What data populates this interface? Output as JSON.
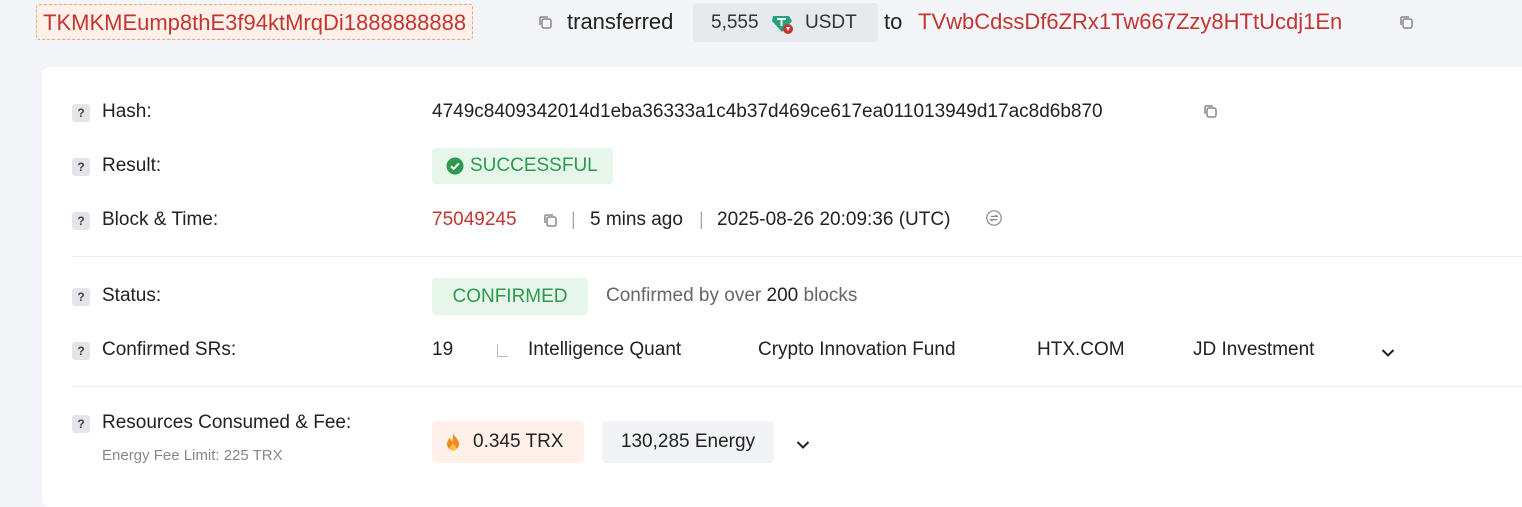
{
  "header": {
    "from_address": "TKMKMEump8thE3f94ktMrqDi1888888888",
    "verb": "transferred",
    "amount": "5,555",
    "token_symbol": "USDT",
    "token_icon": "tether-icon",
    "to_word": "to",
    "to_address": "TVwbCdssDf6ZRx1Tw667Zzy8HTtUcdj1En"
  },
  "details": {
    "hash": {
      "label": "Hash:",
      "value": "4749c8409342014d1eba36333a1c4b37d469ce617ea011013949d17ac8d6b870"
    },
    "result": {
      "label": "Result:",
      "value": "SUCCESSFUL"
    },
    "block_time": {
      "label": "Block & Time:",
      "block": "75049245",
      "sep": "|",
      "ago": "5 mins ago",
      "timestamp": "2025-08-26 20:09:36 (UTC)"
    },
    "status": {
      "label": "Status:",
      "value": "CONFIRMED",
      "note_prefix": "Confirmed by over",
      "note_count": "200",
      "note_suffix": "blocks"
    },
    "confirmed_srs": {
      "label": "Confirmed SRs:",
      "count": "19",
      "names": [
        "Intelligence Quant",
        "Crypto Innovation Fund",
        "HTX.COM",
        "JD Investment"
      ]
    },
    "resources": {
      "label": "Resources Consumed & Fee:",
      "sublabel": "Energy Fee Limit: 225 TRX",
      "fee": "0.345 TRX",
      "energy": "130,285 Energy"
    }
  },
  "colors": {
    "address_red": "#c23631",
    "success_green": "#2d9a4c",
    "success_bg": "#e6f6ea",
    "page_bg": "#f4f5f8"
  },
  "help_glyph": "?"
}
